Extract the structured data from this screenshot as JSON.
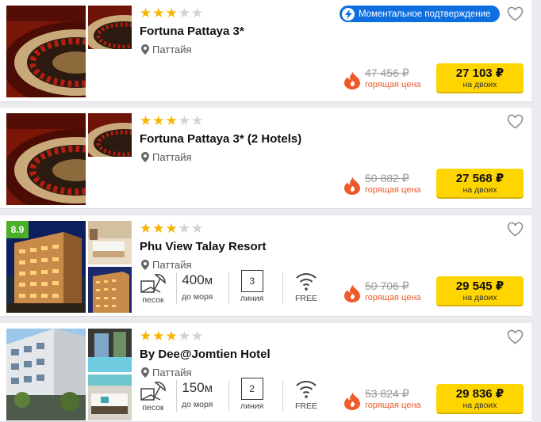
{
  "hotels": [
    {
      "name": "Fortuna Pattaya 3*",
      "stars": 3,
      "city": "Паттайя",
      "instant_badge": "Моментальное подтверждение",
      "old_price": "47 456 ₽",
      "hot_label": "горящая цена",
      "price": "27 103 ₽",
      "price_note": "на двоих",
      "photo": "roulette"
    },
    {
      "name": "Fortuna Pattaya 3* (2 Hotels)",
      "stars": 3,
      "city": "Паттайя",
      "old_price": "50 882 ₽",
      "hot_label": "горящая цена",
      "price": "27 568 ₽",
      "price_note": "на двоих",
      "photo": "roulette"
    },
    {
      "name": "Phu View Talay Resort",
      "stars": 3,
      "city": "Паттайя",
      "rating": "8.9",
      "features": {
        "beach_label": "песок",
        "distance_value": "400",
        "distance_unit": "м",
        "distance_label": "до моря",
        "line_value": "3",
        "line_label": "линия",
        "wifi_label": "FREE"
      },
      "old_price": "50 706 ₽",
      "hot_label": "горящая цена",
      "price": "29 545 ₽",
      "price_note": "на двоих",
      "photo": "night-building"
    },
    {
      "name": "By Dee@Jomtien Hotel",
      "stars": 3,
      "city": "Паттайя",
      "features": {
        "beach_label": "песок",
        "distance_value": "150",
        "distance_unit": "м",
        "distance_label": "до моря",
        "line_value": "2",
        "line_label": "линия",
        "wifi_label": "FREE"
      },
      "old_price": "53 824 ₽",
      "hot_label": "горящая цена",
      "price": "29 836 ₽",
      "price_note": "на двоих",
      "photo": "day-building"
    }
  ],
  "icons": {
    "star": "star-icon",
    "pin": "location-pin-icon",
    "heart": "heart-icon",
    "fire": "fire-icon",
    "bolt": "lightning-icon",
    "beach": "beach-umbrella-icon",
    "wifi": "wifi-icon"
  },
  "colors": {
    "price_button": "#ffd500",
    "hot": "#f0592a",
    "instant_badge": "#0d6fdf",
    "star_on": "#f7b500",
    "rating_badge": "#4caf2a"
  }
}
